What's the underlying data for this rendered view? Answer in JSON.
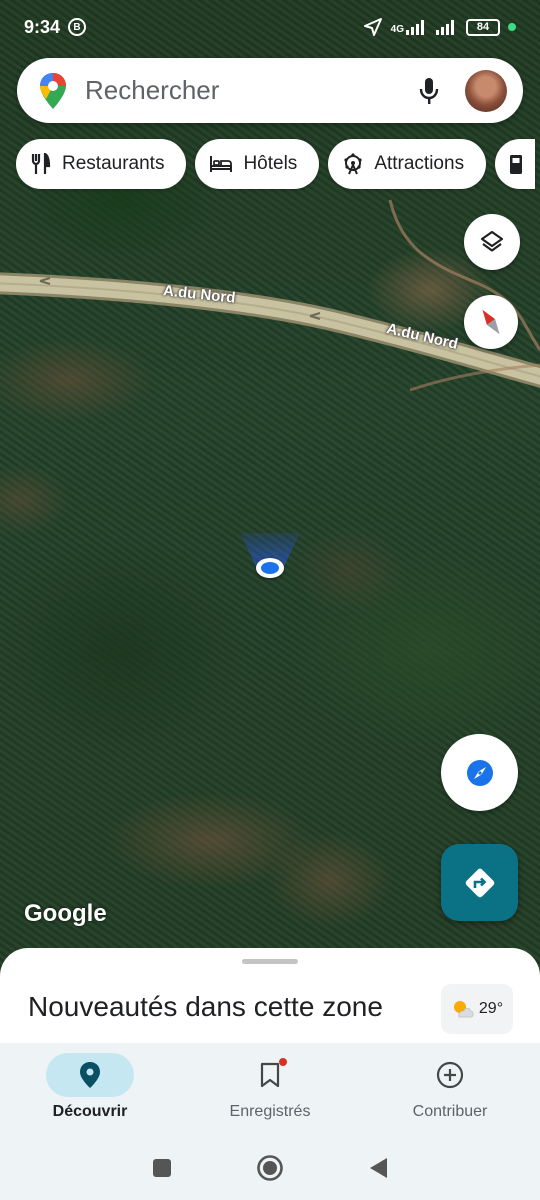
{
  "status_bar": {
    "time": "9:34",
    "b_badge": "B",
    "network": "4G",
    "battery": "84"
  },
  "search": {
    "placeholder": "Rechercher"
  },
  "chips": [
    {
      "label": "Restaurants",
      "icon": "fork-knife-icon"
    },
    {
      "label": "Hôtels",
      "icon": "bed-icon"
    },
    {
      "label": "Attractions",
      "icon": "ferris-wheel-icon"
    },
    {
      "label": "",
      "icon": "gas-station-icon"
    }
  ],
  "map": {
    "road_labels": [
      "A.du Nord",
      "A.du Nord"
    ],
    "attribution": "Google"
  },
  "sheet": {
    "title": "Nouveautés dans cette zone",
    "weather": {
      "temperature": "29°",
      "icon": "partly-sunny-icon"
    }
  },
  "bottom_nav": [
    {
      "label": "Découvrir",
      "icon": "location-pin-icon",
      "active": true
    },
    {
      "label": "Enregistrés",
      "icon": "bookmark-icon",
      "active": false,
      "badge": true
    },
    {
      "label": "Contribuer",
      "icon": "add-circle-icon",
      "active": false
    }
  ],
  "colors": {
    "accent": "#1a73e8",
    "directions_button": "#0b7285",
    "active_nav_bg": "#c5e7f2",
    "badge": "#d93025"
  }
}
